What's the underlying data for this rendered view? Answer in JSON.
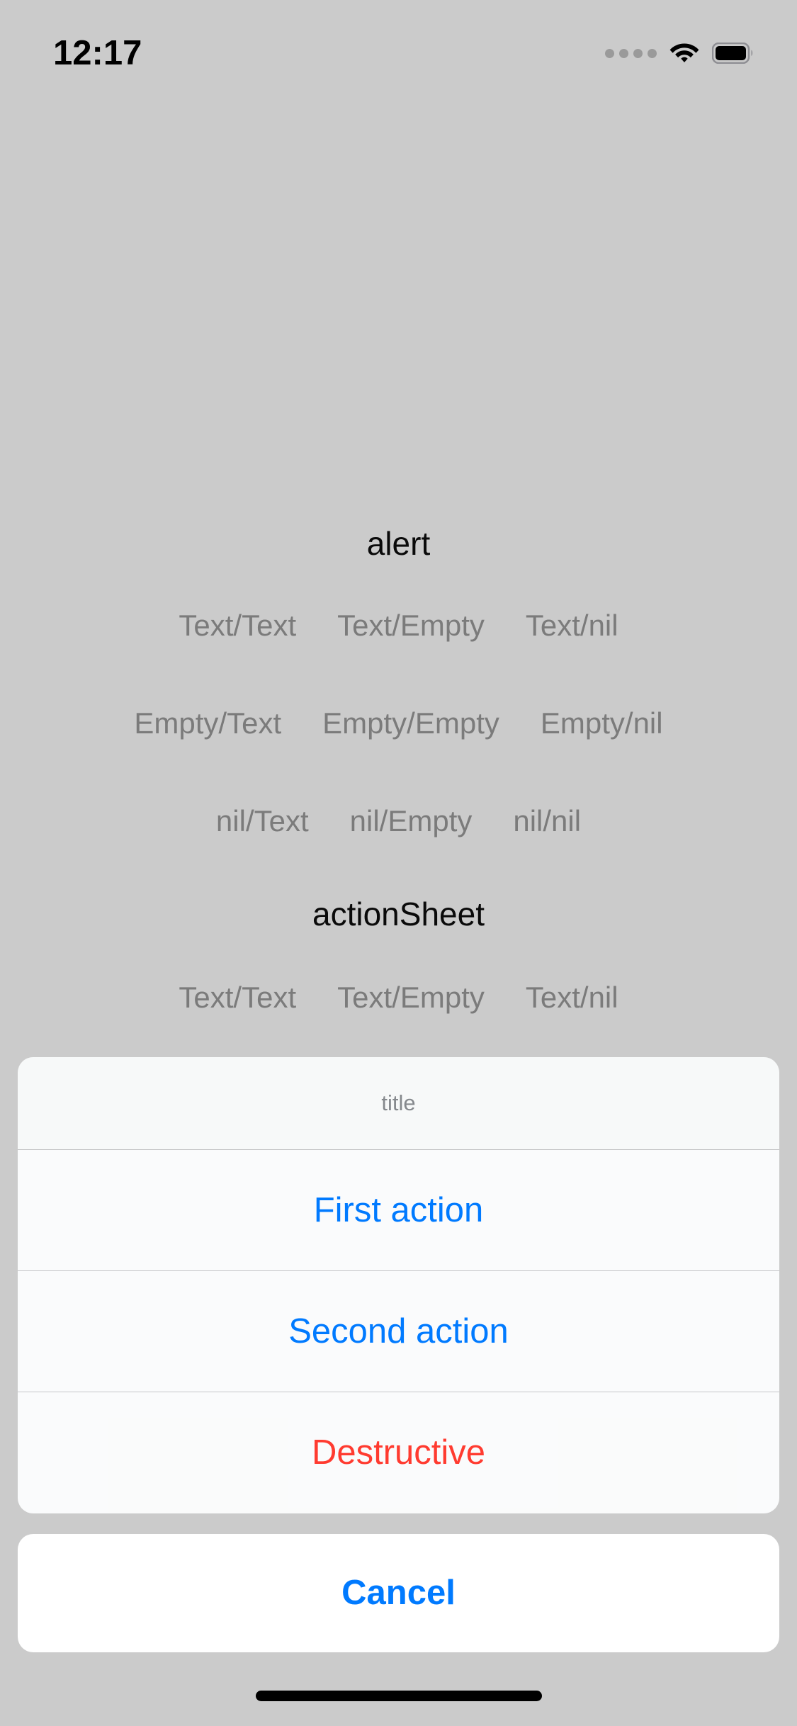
{
  "status_bar": {
    "time": "12:17",
    "signal_icon": "signal-dots-icon",
    "wifi_icon": "wifi-icon",
    "battery_icon": "battery-full-icon"
  },
  "colors": {
    "background": "#cbcbcb",
    "tint_blue": "#007AFF",
    "destructive_red": "#FF3B30",
    "disabled_gray": "#7b7b7b",
    "title_gray": "#85898d",
    "sheet_white": "#ffffff"
  },
  "page": {
    "sections": [
      {
        "heading": "alert",
        "rows": [
          [
            "Text/Text",
            "Text/Empty",
            "Text/nil"
          ],
          [
            "Empty/Text",
            "Empty/Empty",
            "Empty/nil"
          ],
          [
            "nil/Text",
            "nil/Empty",
            "nil/nil"
          ]
        ]
      },
      {
        "heading": "actionSheet",
        "rows": [
          [
            "Text/Text",
            "Text/Empty",
            "Text/nil"
          ]
        ]
      }
    ]
  },
  "action_sheet": {
    "title": "title",
    "actions": [
      {
        "label": "First action",
        "style": "default"
      },
      {
        "label": "Second action",
        "style": "default"
      },
      {
        "label": "Destructive",
        "style": "destructive"
      }
    ],
    "cancel": {
      "label": "Cancel",
      "style": "cancel"
    }
  }
}
